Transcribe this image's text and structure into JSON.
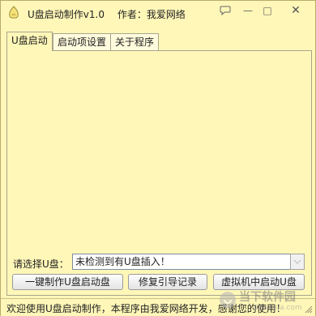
{
  "window": {
    "title": "U盘启动制作v1.0",
    "author": "作者：我爱网络",
    "feedback_icon": "feedback-icon",
    "min_glyph": "—",
    "max_glyph": "□",
    "close_glyph": "✕"
  },
  "tabs": [
    {
      "label": "U盘启动",
      "active": true
    },
    {
      "label": "启动项设置",
      "active": false
    },
    {
      "label": "关于程序",
      "active": false
    }
  ],
  "drive_select": {
    "label": "请选择U盘：",
    "value": "未检测到有U盘插入！"
  },
  "buttons": {
    "make": "一键制作U盘启动盘",
    "repair": "修复引导记录",
    "vm_boot": "虚拟机中启动U盘"
  },
  "status": {
    "text": "欢迎使用U盘启动制作，本程序由我爱网络开发，感谢您的使用！"
  },
  "watermark": {
    "text": "当下软件园",
    "sub": "downxia.com"
  },
  "colors": {
    "background": "#fff7b8",
    "border": "#a9a58d"
  }
}
